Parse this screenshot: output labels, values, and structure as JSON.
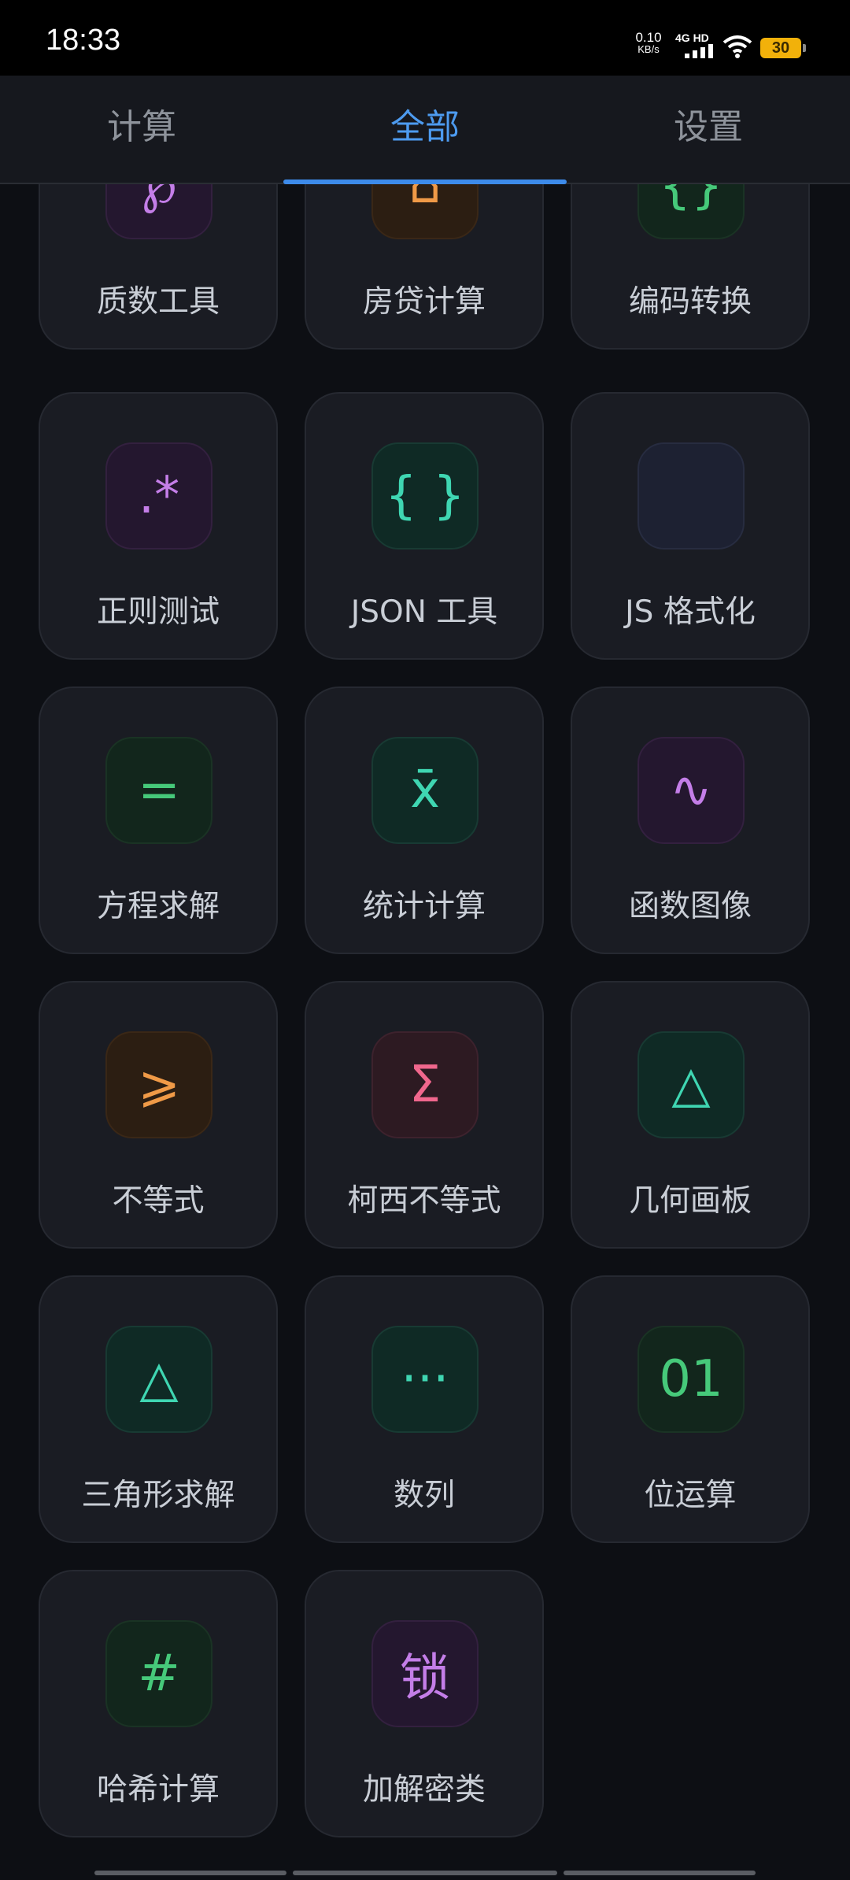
{
  "status_bar": {
    "time": "18:33",
    "net_speed_value": "0.10",
    "net_speed_unit": "KB/s",
    "network_label": "4G HD",
    "battery": "30"
  },
  "tabs": [
    {
      "label": "计算",
      "active": false
    },
    {
      "label": "全部",
      "active": true
    },
    {
      "label": "设置",
      "active": false
    }
  ],
  "tools": [
    {
      "label": "质数工具",
      "icon": "℘",
      "icon_name": "weierstrass-p-icon"
    },
    {
      "label": "房贷计算",
      "icon": "⌂",
      "icon_name": "house-icon"
    },
    {
      "label": "编码转换",
      "icon": "{}",
      "icon_name": "braces-icon"
    },
    {
      "label": "正则测试",
      "icon": ".*",
      "icon_name": "regex-icon"
    },
    {
      "label": "JSON 工具",
      "icon": "{ }",
      "icon_name": "json-braces-icon"
    },
    {
      "label": "JS 格式化",
      "icon": "",
      "icon_name": "js-format-icon"
    },
    {
      "label": "方程求解",
      "icon": "=",
      "icon_name": "equals-icon"
    },
    {
      "label": "统计计算",
      "icon": "x̄",
      "icon_name": "mean-icon"
    },
    {
      "label": "函数图像",
      "icon": "∿",
      "icon_name": "wave-icon"
    },
    {
      "label": "不等式",
      "icon": "⩾",
      "icon_name": "inequality-icon"
    },
    {
      "label": "柯西不等式",
      "icon": "Σ",
      "icon_name": "sigma-icon"
    },
    {
      "label": "几何画板",
      "icon": "△",
      "icon_name": "triangle-icon"
    },
    {
      "label": "三角形求解",
      "icon": "△",
      "icon_name": "triangle-icon"
    },
    {
      "label": "数列",
      "icon": "···",
      "icon_name": "ellipsis-icon"
    },
    {
      "label": "位运算",
      "icon": "01",
      "icon_name": "binary-icon"
    },
    {
      "label": "哈希计算",
      "icon": "#",
      "icon_name": "hash-icon"
    },
    {
      "label": "加解密类",
      "icon": "锁",
      "icon_name": "lock-icon"
    }
  ]
}
